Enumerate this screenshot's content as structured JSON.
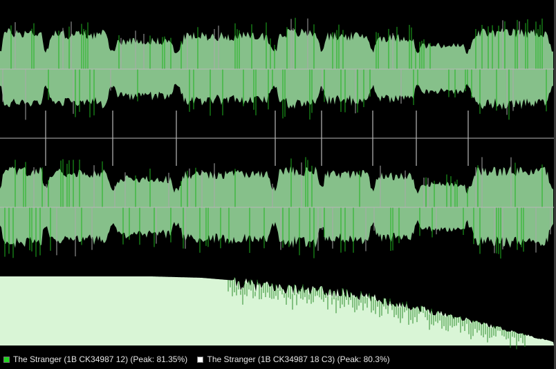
{
  "colors": {
    "background": "#000000",
    "waveform_fill": "#86c08a",
    "waveform_peak_track1": "#1fb31f",
    "waveform_peak_track2": "#a9a9a9",
    "axis_line": "#b8b8b8",
    "spectrum_fill": "#d9f5d6",
    "spectrum_edge": "#2a8a2a"
  },
  "legend": [
    {
      "icon": "green-square-icon",
      "color": "#1fd41f",
      "label": "The Stranger (1B CK34987 12) (Peak: 81.35%)"
    },
    {
      "icon": "white-square-icon",
      "color": "#ffffff",
      "label": "The Stranger (1B CK34987 18 C3) (Peak: 80.3%)"
    }
  ],
  "tracks": {
    "segment_boundaries": [
      0.082,
      0.203,
      0.318,
      0.497,
      0.58,
      0.673,
      0.752,
      0.845
    ],
    "segment_levels": [
      0.8,
      0.75,
      0.55,
      0.7,
      0.8,
      0.7,
      0.65,
      0.4,
      0.8,
      0.4,
      0.2
    ]
  },
  "spectrum": {
    "levels": [
      1.0,
      1.0,
      1.0,
      1.0,
      0.98,
      0.92,
      0.85,
      0.78,
      0.62,
      0.45,
      0.25,
      0.05
    ]
  }
}
